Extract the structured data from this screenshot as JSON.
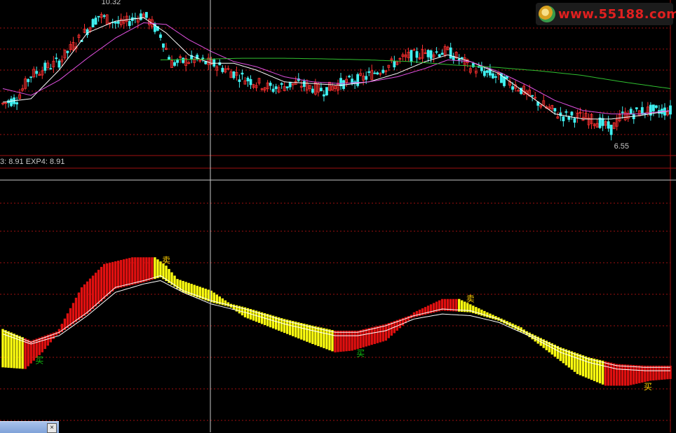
{
  "watermark": {
    "text": "www.55188.com"
  },
  "indicator": {
    "label": "3: 8.91  EXP4: 8.91"
  },
  "taskbar": {
    "close_label": "×"
  },
  "colors": {
    "up_candle": "#ff3030",
    "down_candle": "#40f0f0",
    "ma_short": "#ffffff",
    "ma_mid": "#e050e0",
    "ma_long": "#30c030",
    "osc_red": "#e01010",
    "osc_yellow": "#ffff10",
    "grid": "#a01010",
    "crosshair": "#c8c8c8"
  },
  "chart_data": [
    {
      "type": "candlestick",
      "price_labels": [
        {
          "text": "10.32",
          "at_bar": 34
        },
        {
          "text": "6.55",
          "at_bar": 216
        }
      ],
      "ylim": [
        6.3,
        10.45
      ],
      "bar_count": 238,
      "series": [
        {
          "name": "",
          "line": "ma_short",
          "points": [
            [
              0,
              7.55
            ],
            [
              10,
              7.65
            ],
            [
              20,
              8.5
            ],
            [
              30,
              9.6
            ],
            [
              40,
              9.95
            ],
            [
              50,
              10.05
            ],
            [
              58,
              9.6
            ],
            [
              66,
              8.95
            ],
            [
              74,
              8.7
            ],
            [
              82,
              8.7
            ],
            [
              90,
              8.5
            ],
            [
              100,
              8.15
            ],
            [
              110,
              8.1
            ],
            [
              120,
              8.05
            ],
            [
              130,
              8.15
            ],
            [
              140,
              8.4
            ],
            [
              150,
              8.75
            ],
            [
              158,
              8.95
            ],
            [
              166,
              8.75
            ],
            [
              176,
              8.4
            ],
            [
              186,
              7.8
            ],
            [
              196,
              7.2
            ],
            [
              206,
              7.05
            ],
            [
              216,
              7.05
            ],
            [
              226,
              7.15
            ],
            [
              237,
              7.3
            ]
          ]
        },
        {
          "name": "",
          "line": "ma_mid",
          "points": [
            [
              0,
              7.95
            ],
            [
              10,
              7.75
            ],
            [
              20,
              8.2
            ],
            [
              30,
              8.85
            ],
            [
              40,
              9.45
            ],
            [
              50,
              9.9
            ],
            [
              58,
              9.85
            ],
            [
              66,
              9.4
            ],
            [
              74,
              9.05
            ],
            [
              82,
              8.75
            ],
            [
              90,
              8.6
            ],
            [
              100,
              8.3
            ],
            [
              110,
              8.15
            ],
            [
              120,
              8.1
            ],
            [
              130,
              8.15
            ],
            [
              140,
              8.3
            ],
            [
              150,
              8.55
            ],
            [
              158,
              8.8
            ],
            [
              166,
              8.75
            ],
            [
              176,
              8.45
            ],
            [
              186,
              8.05
            ],
            [
              196,
              7.6
            ],
            [
              206,
              7.3
            ],
            [
              216,
              7.2
            ],
            [
              226,
              7.2
            ],
            [
              237,
              7.3
            ]
          ]
        },
        {
          "name": "",
          "line": "ma_long",
          "start_bar": 56,
          "points": [
            [
              56,
              8.8
            ],
            [
              70,
              8.82
            ],
            [
              85,
              8.85
            ],
            [
              100,
              8.85
            ],
            [
              115,
              8.83
            ],
            [
              130,
              8.8
            ],
            [
              145,
              8.75
            ],
            [
              160,
              8.65
            ],
            [
              175,
              8.58
            ],
            [
              190,
              8.48
            ],
            [
              205,
              8.35
            ],
            [
              220,
              8.15
            ],
            [
              237,
              7.95
            ]
          ]
        },
        {
          "name": "",
          "candles": "up_candle/down_candle",
          "trend": [
            [
              0,
              7.5
            ],
            [
              5,
              7.65
            ],
            [
              10,
              8.35
            ],
            [
              20,
              8.75
            ],
            [
              28,
              9.5
            ],
            [
              34,
              10.1
            ],
            [
              42,
              9.85
            ],
            [
              50,
              10.15
            ],
            [
              56,
              9.55
            ],
            [
              60,
              8.7
            ],
            [
              68,
              8.8
            ],
            [
              76,
              8.65
            ],
            [
              86,
              8.25
            ],
            [
              96,
              7.95
            ],
            [
              104,
              8.1
            ],
            [
              114,
              7.9
            ],
            [
              120,
              8.1
            ],
            [
              128,
              8.25
            ],
            [
              136,
              8.6
            ],
            [
              144,
              8.9
            ],
            [
              150,
              9.0
            ],
            [
              158,
              9.05
            ],
            [
              166,
              8.6
            ],
            [
              174,
              8.35
            ],
            [
              182,
              8.05
            ],
            [
              190,
              7.55
            ],
            [
              198,
              7.15
            ],
            [
              206,
              7.1
            ],
            [
              212,
              6.95
            ],
            [
              216,
              6.75
            ],
            [
              220,
              7.15
            ],
            [
              228,
              7.3
            ],
            [
              237,
              7.3
            ]
          ]
        }
      ]
    },
    {
      "type": "bar",
      "title": "",
      "ylim": [
        0,
        1
      ],
      "bar_count": 238,
      "bar_value": [
        [
          0,
          0.16
        ],
        [
          8,
          0.15
        ],
        [
          14,
          0.25
        ],
        [
          20,
          0.37
        ],
        [
          28,
          0.62
        ],
        [
          36,
          0.76
        ],
        [
          46,
          0.8
        ],
        [
          54,
          0.8
        ],
        [
          58,
          0.75
        ],
        [
          62,
          0.67
        ],
        [
          74,
          0.6
        ],
        [
          86,
          0.46
        ],
        [
          98,
          0.38
        ],
        [
          110,
          0.3
        ],
        [
          118,
          0.25
        ],
        [
          124,
          0.26
        ],
        [
          136,
          0.32
        ],
        [
          146,
          0.47
        ],
        [
          156,
          0.55
        ],
        [
          162,
          0.55
        ],
        [
          172,
          0.47
        ],
        [
          184,
          0.38
        ],
        [
          194,
          0.25
        ],
        [
          204,
          0.12
        ],
        [
          214,
          0.05
        ],
        [
          222,
          0.05
        ],
        [
          230,
          0.08
        ],
        [
          237,
          0.09
        ]
      ],
      "signal_fast": [
        [
          0,
          0.37
        ],
        [
          10,
          0.3
        ],
        [
          20,
          0.36
        ],
        [
          30,
          0.48
        ],
        [
          40,
          0.63
        ],
        [
          50,
          0.67
        ],
        [
          56,
          0.7
        ],
        [
          64,
          0.61
        ],
        [
          74,
          0.55
        ],
        [
          86,
          0.5
        ],
        [
          100,
          0.43
        ],
        [
          110,
          0.39
        ],
        [
          118,
          0.36
        ],
        [
          126,
          0.36
        ],
        [
          136,
          0.4
        ],
        [
          146,
          0.46
        ],
        [
          156,
          0.5
        ],
        [
          166,
          0.49
        ],
        [
          176,
          0.44
        ],
        [
          188,
          0.34
        ],
        [
          198,
          0.26
        ],
        [
          208,
          0.2
        ],
        [
          218,
          0.16
        ],
        [
          228,
          0.15
        ],
        [
          237,
          0.15
        ]
      ],
      "signal_slow": [
        [
          0,
          0.35
        ],
        [
          10,
          0.29
        ],
        [
          20,
          0.34
        ],
        [
          30,
          0.46
        ],
        [
          40,
          0.6
        ],
        [
          50,
          0.65
        ],
        [
          56,
          0.67
        ],
        [
          64,
          0.6
        ],
        [
          74,
          0.53
        ],
        [
          86,
          0.48
        ],
        [
          100,
          0.41
        ],
        [
          110,
          0.37
        ],
        [
          118,
          0.34
        ],
        [
          126,
          0.34
        ],
        [
          136,
          0.37
        ],
        [
          146,
          0.44
        ],
        [
          156,
          0.47
        ],
        [
          166,
          0.46
        ],
        [
          176,
          0.42
        ],
        [
          188,
          0.33
        ],
        [
          198,
          0.24
        ],
        [
          208,
          0.18
        ],
        [
          218,
          0.14
        ],
        [
          228,
          0.13
        ],
        [
          237,
          0.13
        ]
      ],
      "annotations": [
        {
          "text": "买",
          "at_bar": 13,
          "color": "#10c010"
        },
        {
          "text": "卖",
          "at_bar": 58,
          "color": "#ffd000"
        },
        {
          "text": "买",
          "at_bar": 127,
          "color": "#10c010"
        },
        {
          "text": "卖",
          "at_bar": 166,
          "color": "#ffd000"
        },
        {
          "text": "买",
          "at_bar": 229,
          "color": "#ffd000"
        }
      ]
    }
  ]
}
